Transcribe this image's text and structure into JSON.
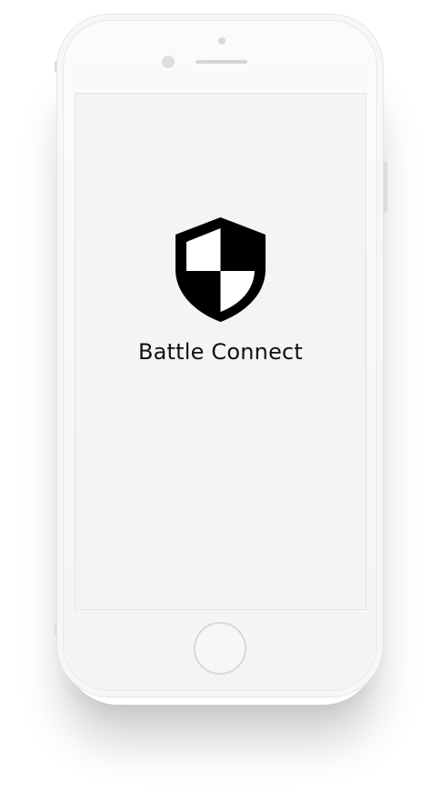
{
  "device": {
    "model_icon": "phone-frame",
    "color": "#f5f5f5"
  },
  "screen": {
    "background": "#f4f4f4",
    "logo_icon": "shield-icon",
    "app_title": "Battle Connect"
  }
}
